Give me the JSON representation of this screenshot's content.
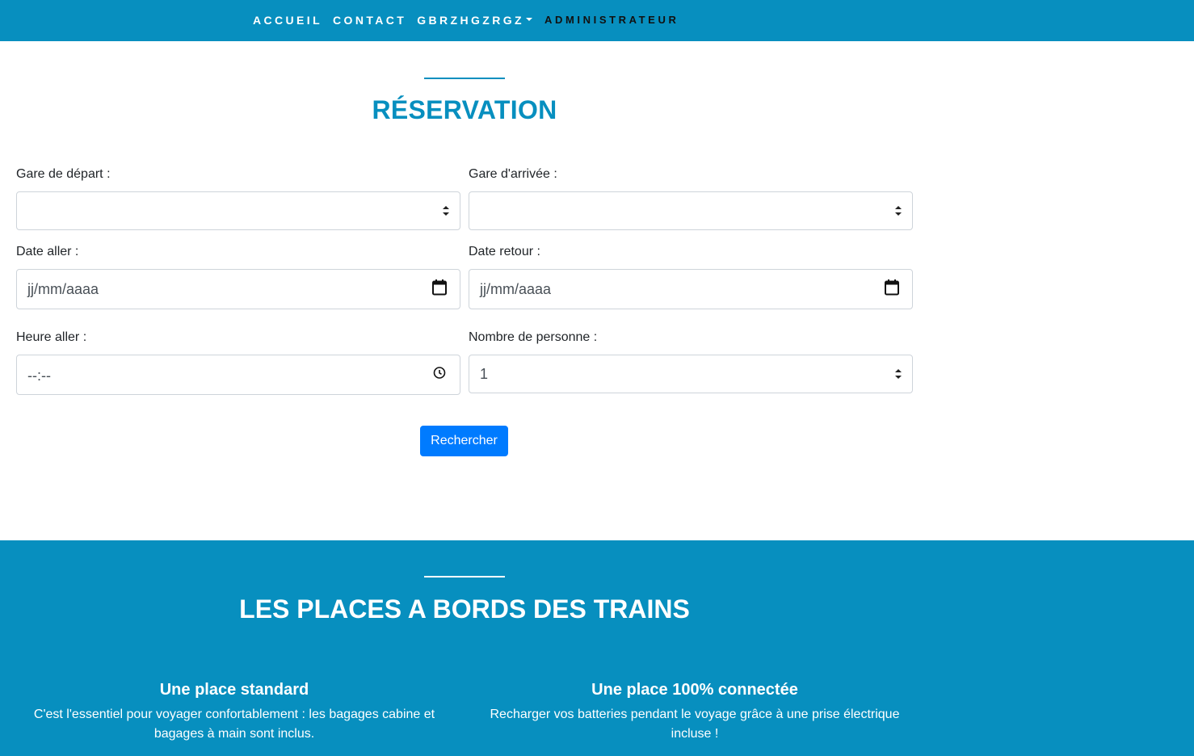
{
  "nav": {
    "items": [
      {
        "label": "ACCUEIL"
      },
      {
        "label": "CONTACT"
      },
      {
        "label": "GBRZHGZRGZ"
      },
      {
        "label": "ADMINISTRATEUR"
      }
    ]
  },
  "reservation": {
    "title": "RÉSERVATION",
    "departure_label": "Gare de départ :",
    "departure_value": "",
    "arrival_label": "Gare d'arrivée :",
    "arrival_value": "",
    "date_out_label": "Date aller :",
    "date_out_value": "jj/mm/aaaa",
    "date_return_label": "Date retour :",
    "date_return_value": "jj/mm/aaaa",
    "time_out_label": "Heure aller :",
    "time_out_value": "--:--",
    "persons_label": "Nombre de personne :",
    "persons_value": "1",
    "search_button": "Rechercher"
  },
  "places": {
    "title": "LES PLACES A BORDS DES TRAINS",
    "features": [
      {
        "title": "Une place standard",
        "text": "C'est l'essentiel pour voyager confortablement : les bagages cabine et bagages à main sont inclus."
      },
      {
        "title": "Une place 100% connectée",
        "text": "Recharger vos batteries pendant le voyage grâce à une prise électrique incluse !"
      }
    ]
  },
  "colors": {
    "brand": "#078fbf",
    "button": "#007bff"
  }
}
